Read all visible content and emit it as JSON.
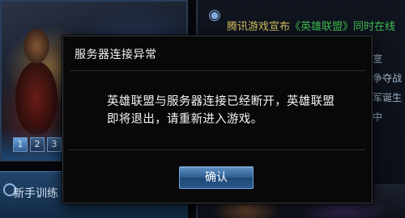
{
  "background": {
    "pager": [
      "1",
      "2",
      "3"
    ],
    "trainer_label": "新手训练",
    "news_icon": "globe-icon",
    "news_headline_prefix": "腾讯游戏宣布",
    "news_headline_main": "《英雄联盟》同时在线",
    "news_items": [
      "室",
      "争夺战",
      "军诞生",
      "中"
    ]
  },
  "dialog": {
    "title": "服务器连接异常",
    "message": "英雄联盟与服务器连接已经断开，英雄联盟即将退出，请重新进入游戏。",
    "confirm_label": "确认"
  },
  "colors": {
    "dialog_bg": "#080808",
    "button_accent": "#2f5f93",
    "headline_green": "#3fbf52"
  }
}
